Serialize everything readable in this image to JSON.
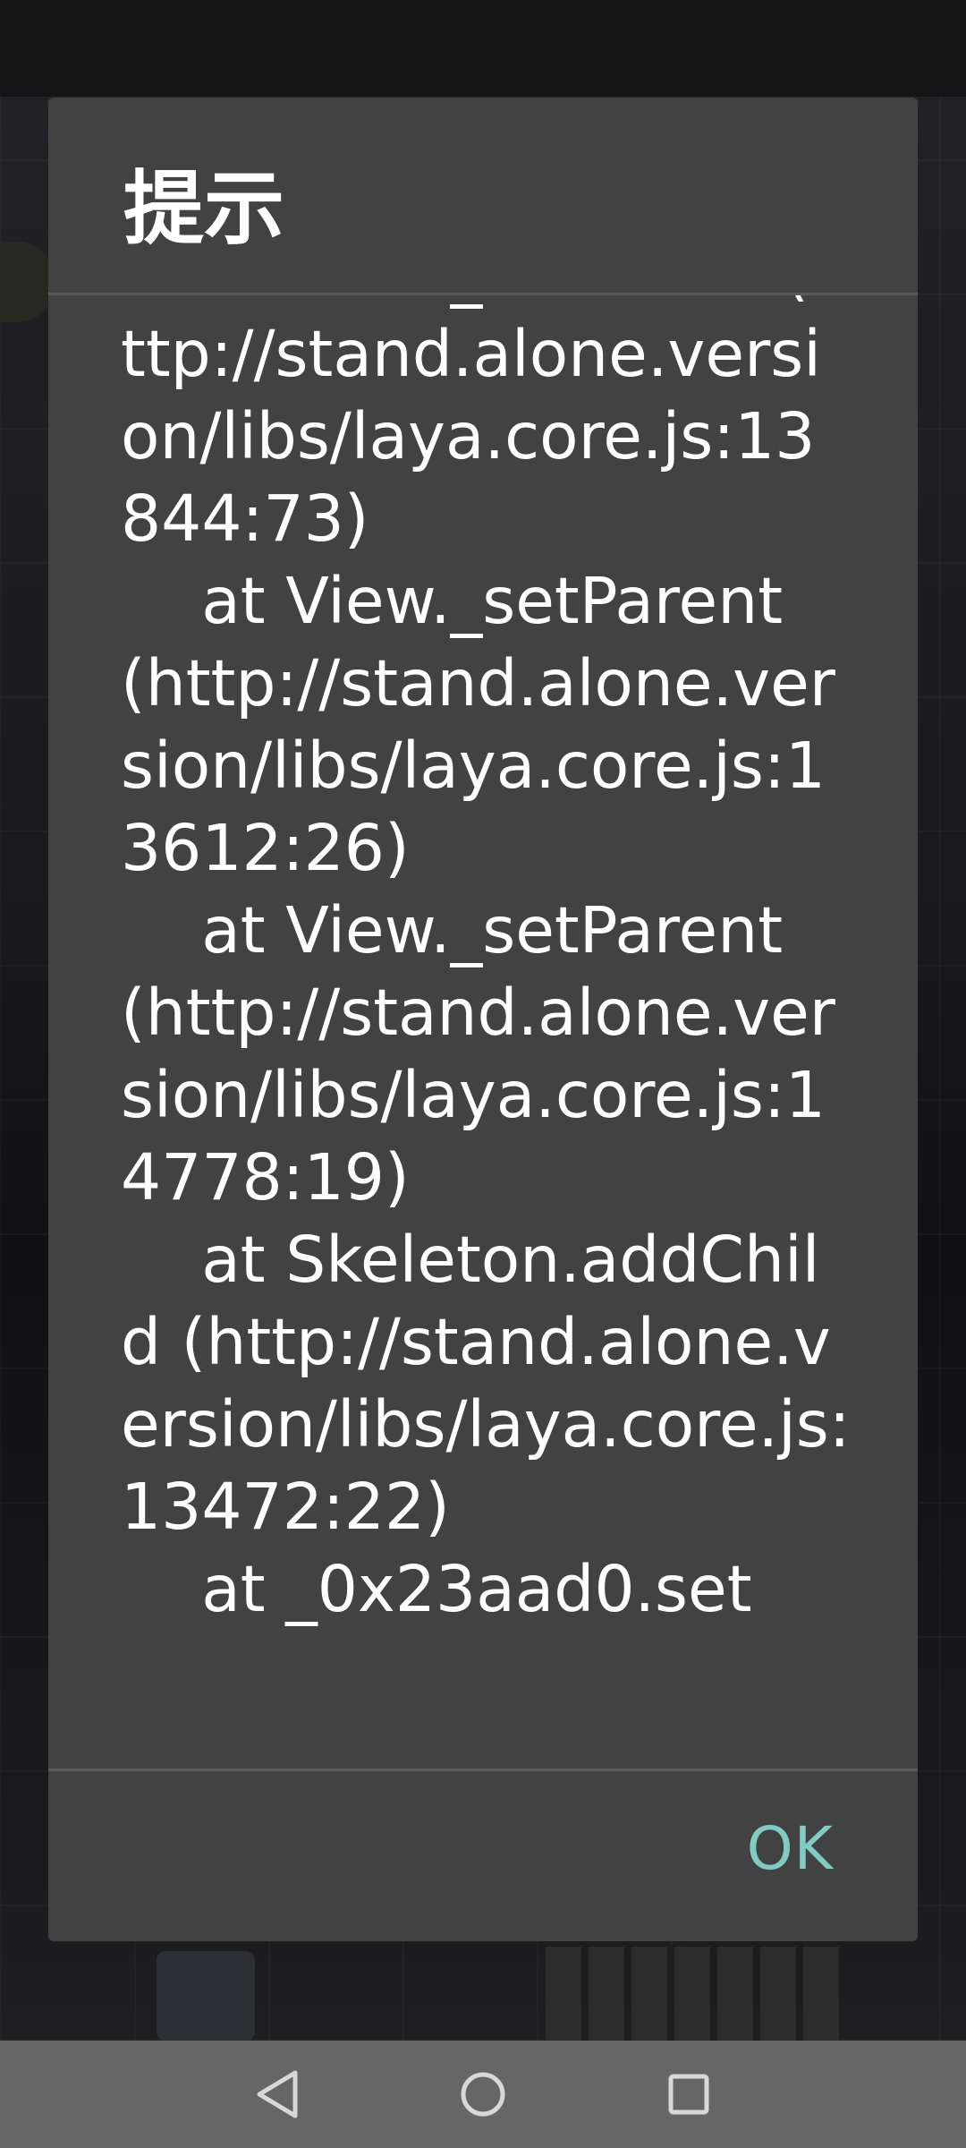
{
  "dialog": {
    "title": "提示",
    "message": "    at View._onAdded (http://stand.alone.version/libs/laya.core.js:13844:73)\n    at View._setParent (http://stand.alone.version/libs/laya.core.js:13612:26)\n    at View._setParent (http://stand.alone.version/libs/laya.core.js:14778:19)\n    at Skeleton.addChild (http://stand.alone.version/libs/laya.core.js:13472:22)\n    at _0x23aad0.set",
    "ok_label": "OK"
  },
  "colors": {
    "dialog_bg": "#424242",
    "accent": "#80cbc4",
    "navbar_bg": "#666666"
  },
  "navbar": {
    "icons": [
      "back-icon",
      "home-icon",
      "recent-apps-icon"
    ]
  }
}
